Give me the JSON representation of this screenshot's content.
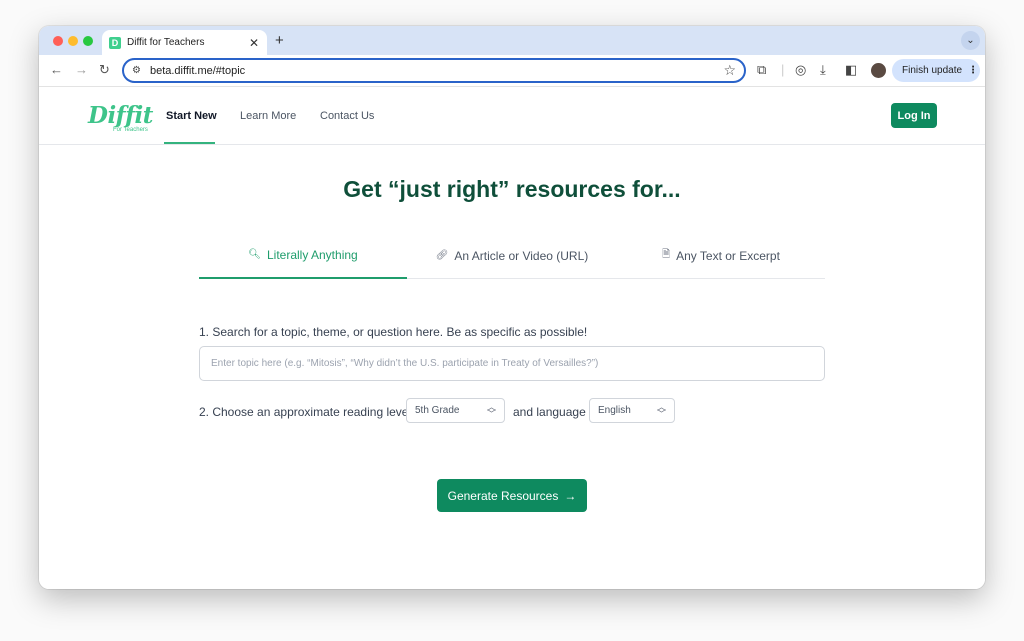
{
  "browser": {
    "tab_title": "Diffit for Teachers",
    "tab_favicon_letter": "D",
    "new_tab_icon": "plus-icon",
    "url": "beta.diffit.me/#topic",
    "finish_update_label": "Finish update"
  },
  "site": {
    "logo": "Diffit",
    "logo_sub": "For Teachers",
    "nav": {
      "start_new": "Start New",
      "learn_more": "Learn More",
      "contact_us": "Contact Us",
      "login": "Log In"
    },
    "hero_title": "Get “just right” resources for...",
    "tabs": [
      {
        "label": "Literally Anything",
        "icon": "search-icon",
        "active": true
      },
      {
        "label": "An Article or Video (URL)",
        "icon": "link-icon",
        "active": false
      },
      {
        "label": "Any Text or Excerpt",
        "icon": "document-icon",
        "active": false
      }
    ],
    "step1_label": "1. Search for a topic, theme, or question here. Be as specific as possible!",
    "topic_placeholder": "Enter topic here (e.g. “Mitosis”, “Why didn’t the U.S. participate in Treaty of Versailles?”)",
    "step2_label": "2. Choose an approximate reading level",
    "reading_level": "5th Grade",
    "and_language_label": "and language",
    "language": "English",
    "generate_label": "Generate Resources"
  },
  "colors": {
    "brand_green": "#0e8a5f",
    "logo_green": "#3ec48a",
    "hero_text": "#0f4f3a",
    "tab_strip": "#d7e3f6"
  }
}
